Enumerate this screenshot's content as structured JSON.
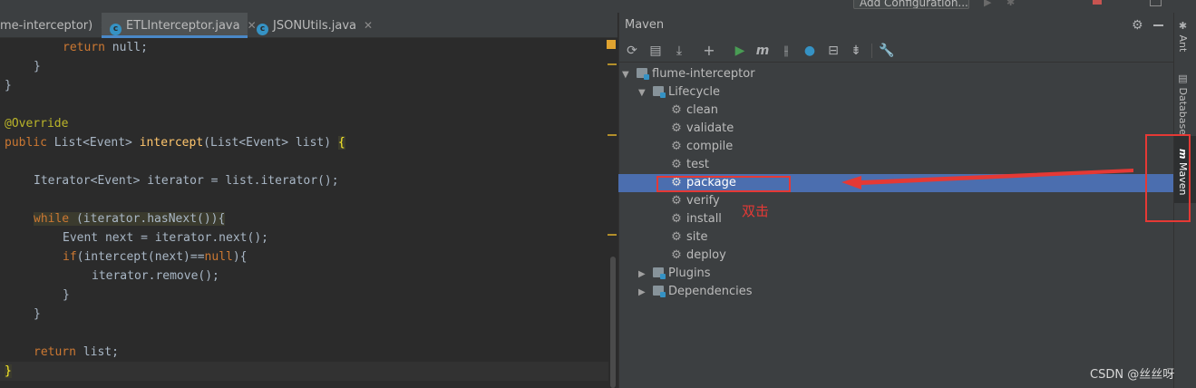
{
  "toolbar": {
    "run_config_label": "Add Configuration..."
  },
  "tabs": [
    {
      "label": "me-interceptor)",
      "active": false
    },
    {
      "label": "ETLInterceptor.java",
      "active": true,
      "icon": "java-class-icon"
    },
    {
      "label": "JSONUtils.java",
      "active": false,
      "icon": "java-class-icon"
    }
  ],
  "code": {
    "l1": "return",
    "l1b": " null;",
    "l2": "}",
    "l3": "}",
    "l5": "@Override",
    "l6a": "public",
    "l6b": " List<Event> ",
    "l6c": "intercept",
    "l6d": "(List<Event> list) ",
    "l6e": "{",
    "l8": "Iterator<Event> iterator = list.iterator();",
    "l10a": "while",
    "l10b": " (iterator.hasNext()){",
    "l11": "Event next = iterator.next();",
    "l12a": "if",
    "l12b": "(intercept(next)==",
    "l12c": "null",
    "l12d": "){",
    "l13": "iterator.remove();",
    "l14": "}",
    "l15": "}",
    "l17a": "return",
    "l17b": " list;",
    "l18": "}"
  },
  "maven": {
    "title": "Maven",
    "project": "flume-interceptor",
    "lifecycle_label": "Lifecycle",
    "phases": [
      "clean",
      "validate",
      "compile",
      "test",
      "package",
      "verify",
      "install",
      "site",
      "deploy"
    ],
    "selected_phase": "package",
    "plugins_label": "Plugins",
    "dependencies_label": "Dependencies"
  },
  "side_tabs": {
    "ant": "Ant",
    "database": "Database",
    "maven": "Maven"
  },
  "annotation": {
    "text": "双击",
    "color": "#e53935"
  },
  "watermark": "CSDN @丝丝呀",
  "colors": {
    "selection": "#4b6eaf",
    "keyword": "#cc7832",
    "method": "#ffc66d",
    "annotation": "#bbb529"
  }
}
